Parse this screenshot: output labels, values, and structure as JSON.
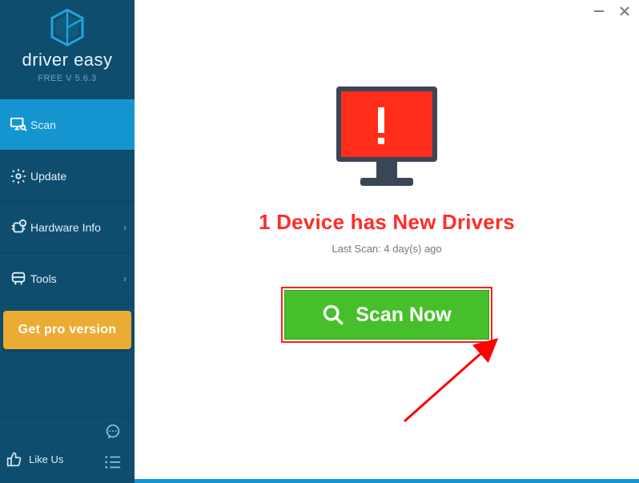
{
  "brand": {
    "name": "driver easy",
    "version": "FREE V 5.6.3"
  },
  "sidebar": {
    "items": [
      {
        "label": "Scan",
        "active": true,
        "expandable": false
      },
      {
        "label": "Update",
        "active": false,
        "expandable": false
      },
      {
        "label": "Hardware Info",
        "active": false,
        "expandable": true
      },
      {
        "label": "Tools",
        "active": false,
        "expandable": true
      }
    ],
    "pro_button": "Get pro version"
  },
  "footer": {
    "like_us": "Like Us"
  },
  "main": {
    "headline": "1 Device has New Drivers",
    "last_scan": "Last Scan: 4 day(s) ago",
    "scan_button": "Scan Now"
  },
  "colors": {
    "sidebar_bg": "#0e4d6e",
    "accent": "#1595d0",
    "pro": "#ebac34",
    "alert": "#ff2d26",
    "scan": "#45c02a"
  }
}
